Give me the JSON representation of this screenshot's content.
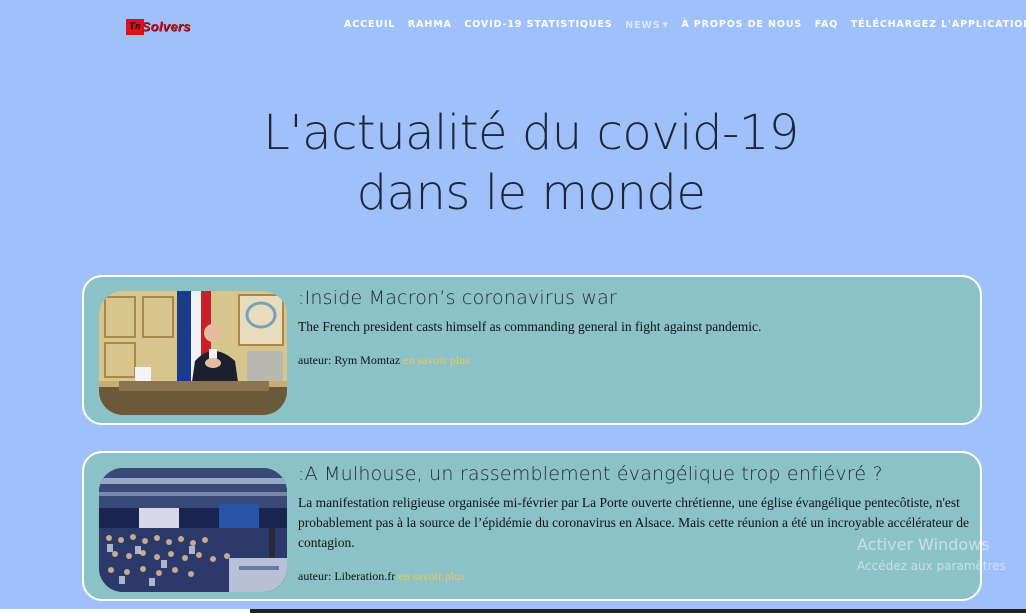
{
  "nav": {
    "logo_prefix": "Tn",
    "logo_text": "Solvers",
    "items": [
      {
        "label": "ACCEUIL"
      },
      {
        "label": "RAHMA"
      },
      {
        "label": "COVID-19 STATISTIQUES"
      },
      {
        "label": "NEWS"
      },
      {
        "label": "À PROPOS DE NOUS"
      },
      {
        "label": "FAQ"
      },
      {
        "label": "TÉLÉCHARGEZ L'APPLICATION"
      }
    ]
  },
  "hero": {
    "line1": "L'actualité du covid-19",
    "line2": "dans le monde"
  },
  "articles": [
    {
      "title": ":Inside Macron’s coronavirus war",
      "description": "The French president casts himself as commanding general in fight against pandemic.",
      "author_label": "auteur: Rym Momtaz",
      "read_more": "en savoir plus"
    },
    {
      "title": ":A Mulhouse, un rassemblement évangélique trop enfiévré ?",
      "description": "La manifestation religieuse organisée mi-février par La Porte ouverte chrétienne, une église évangélique pentecôtiste, n'est probablement pas à la source de l’épidémie du coronavirus en Alsace. Mais cette réunion a été un incroyable accélérateur de contagion.",
      "author_label": "auteur: Liberation.fr",
      "read_more": "en savoir plus"
    }
  ],
  "watermark": {
    "line1": "Activer Windows",
    "line2": "Accédez aux paramètres"
  },
  "colors": {
    "background": "#a0c0fc",
    "card": "#8ac2c8",
    "link": "#f5c64a",
    "logo_red": "#d01010"
  }
}
